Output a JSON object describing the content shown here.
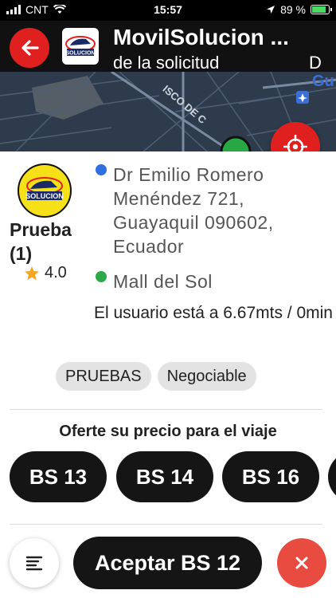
{
  "status_bar": {
    "carrier": "CNT",
    "time": "15:57",
    "battery_percent": "89 %",
    "battery_level": 0.89
  },
  "header": {
    "title": "MovilSolucion ...",
    "subtitle": "de la solicitud",
    "subtitle_trailing": "D",
    "logo_text": "SOLUCION"
  },
  "map": {
    "street_label": "ISCO DE C",
    "poi_label": "Gu Jo Ol"
  },
  "driver": {
    "logo_text": "SOLUCION",
    "name": "Prueba (1)",
    "rating": "4.0"
  },
  "trip": {
    "origin": "Dr Emilio Romero Menéndez 721, Guayaquil 090602, Ecuador",
    "destination": "Mall del Sol",
    "distance_text": "El usuario está a 6.67mts / 0min"
  },
  "tags": [
    "PRUEBAS",
    "Negociable"
  ],
  "offer": {
    "title": "Oferte su precio para el viaje",
    "prices": [
      "BS 13",
      "BS 14",
      "BS 16"
    ]
  },
  "actions": {
    "accept_label": "Aceptar BS 12"
  },
  "colors": {
    "accent_red": "#e0201f",
    "cancel_red": "#e84b3f",
    "dark": "#151515",
    "origin_dot": "#2f6fe0",
    "destination_dot": "#2da84a",
    "star": "#f5a623"
  }
}
